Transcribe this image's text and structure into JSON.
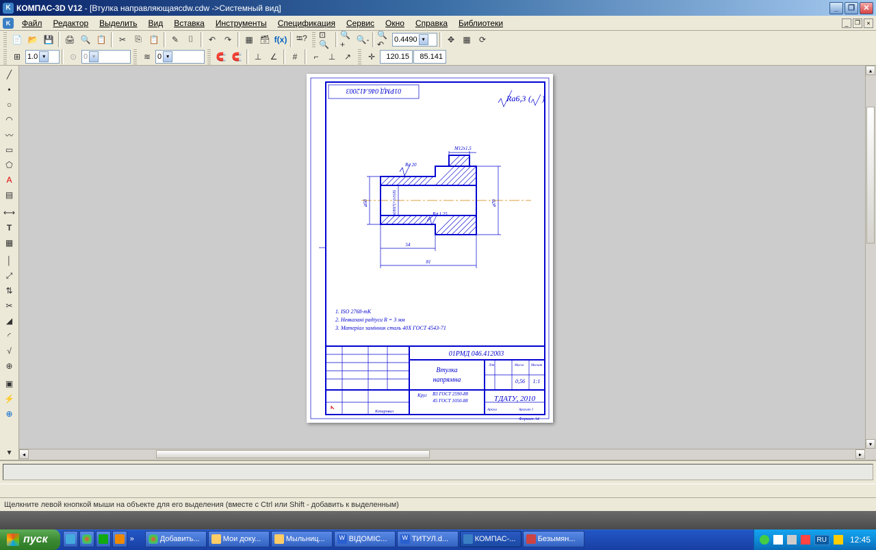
{
  "titlebar": {
    "app": "КОМПАС-3D V12",
    "doc": " - [Втулка направляющаяcdw.cdw ->Системный вид]"
  },
  "menu": {
    "file": "Файл",
    "editor": "Редактор",
    "select": "Выделить",
    "view": "Вид",
    "insert": "Вставка",
    "tools": "Инструменты",
    "spec": "Спецификация",
    "service": "Сервис",
    "window": "Окно",
    "help": "Справка",
    "libs": "Библиотеки"
  },
  "toolbar": {
    "zoom": "0.4490",
    "scale": "1.0",
    "step": "0",
    "layer": "0",
    "coord_x": "120.15",
    "coord_y": "85.141"
  },
  "drawing": {
    "ra_global": "Ra6,3",
    "tl_code_flipped": "01РМД 046.412003",
    "thread": "М12х1,5",
    "ra_top": "Ra 20",
    "ra_bottom": "Ra 1,25",
    "dim_d50": "⌀50",
    "dim_d_inner": "⌀18Н7(+0.018)",
    "dim_d70": "⌀70",
    "dim_l54": "54",
    "dim_l81": "81",
    "notes": {
      "n1": "1. ISO 2768-mK",
      "n2": "2. Невказані радіуси R = 3 мм",
      "n3": "3. Матеріал замінник сталь 40Х ГОСТ 4543-71"
    },
    "title_block": {
      "code": "01РМД 046.412003",
      "name1": "Втулка",
      "name2": "напрямна",
      "mat1": "В3 ГОСТ 2590-88",
      "mat2": "45 ГОСТ 1050-88",
      "mat_label": "Круг",
      "org": "ТДАТУ, 2010",
      "mass": "0,56",
      "sc": "1:1",
      "format": "Формат А4",
      "lit": "Літ",
      "massa": "Масса",
      "masht": "Масшт",
      "copied": "Копировал",
      "ark": "Аркуш",
      "arks": "Аркушів 1"
    }
  },
  "status": "Щелкните левой кнопкой мыши на объекте для его выделения (вместе с Ctrl или Shift - добавить к выделенным)",
  "taskbar": {
    "start": "пуск",
    "items": [
      "Добавить...",
      "Мои доку...",
      "Мыльниц...",
      "ВІДОМІС...",
      "ТИТУЛ.d...",
      "КОМПАС-...",
      "Безымян..."
    ],
    "lang": "RU",
    "clock": "12:45"
  }
}
